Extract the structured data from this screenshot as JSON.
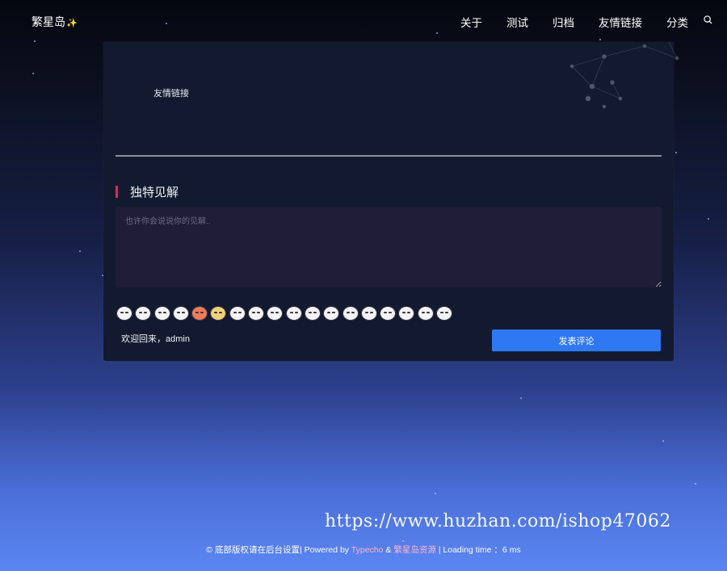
{
  "header": {
    "logo_text": "繁星岛",
    "logo_spark": "✨",
    "nav": [
      "关于",
      "测试",
      "归档",
      "友情链接",
      "分类"
    ],
    "search_icon": "search-icon"
  },
  "card": {
    "friend_link_text": "友情链接",
    "comment_title": "独特见解",
    "textarea_placeholder": "也许你会说说你的见解..",
    "emoji_count": 18,
    "welcome": "欢迎回来，admin",
    "submit_label": "发表评论"
  },
  "watermark": "https://www.huzhan.com/ishop47062",
  "footer": {
    "prefix": "© 底部版权请在后台设置| Powered by ",
    "typecho": "Typecho",
    "amp": " & ",
    "theme": "繁星岛资源",
    "suffix": " | Loading time ：6 ms"
  },
  "colors": {
    "accent": "#2f78f4",
    "title_bar": "#e0245e",
    "card_bg": "#131a2f",
    "pink_link": "#ffb3cf"
  }
}
